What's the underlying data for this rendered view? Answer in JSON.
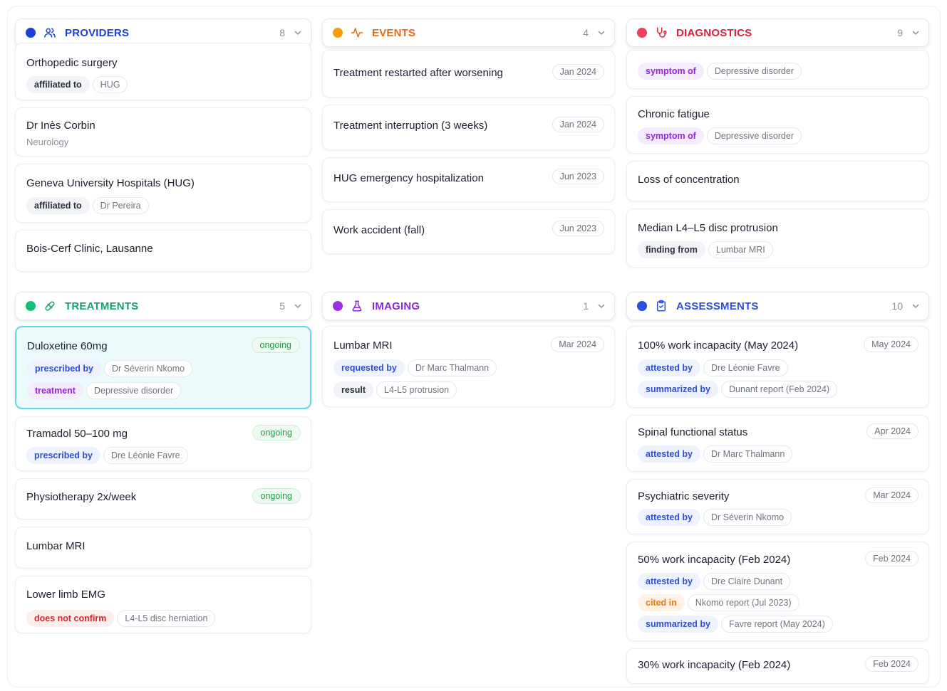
{
  "colors": {
    "providers": "#1e40d8",
    "events": "#f59e0b",
    "events_title": "#ea6a12",
    "diagnostics": "#f03e5f",
    "diagnostics_title": "#dc1f3c",
    "treatments": "#16c07a",
    "treatments_title": "#13a36a",
    "imaging": "#9b30e8",
    "imaging_title": "#8a28d6",
    "assessments": "#2d4fe0"
  },
  "providers": {
    "title": "PROVIDERS",
    "icon": "users-icon",
    "count": "8",
    "cards": [
      {
        "title": "Orthopedic surgery",
        "relation": "affiliated to",
        "target": "HUG"
      },
      {
        "title": "Dr Inès Corbin",
        "subtitle": "Neurology"
      },
      {
        "title": "Geneva University Hospitals (HUG)",
        "relation": "affiliated to",
        "target": "Dr Pereira"
      },
      {
        "title": "Bois-Cerf Clinic, Lausanne"
      }
    ]
  },
  "events": {
    "title": "EVENTS",
    "icon": "activity-icon",
    "count": "4",
    "cards": [
      {
        "title": "Treatment restarted after worsening",
        "date": "Jan 2024"
      },
      {
        "title": "Treatment interruption (3 weeks)",
        "date": "Jan 2024"
      },
      {
        "title": "HUG emergency hospitalization",
        "date": "Jun 2023"
      },
      {
        "title": "Work accident (fall)",
        "date": "Jun 2023"
      }
    ]
  },
  "diagnostics": {
    "title": "DIAGNOSTICS",
    "icon": "stethoscope-icon",
    "count": "9",
    "cards": [
      {
        "relation": "symptom of",
        "target": "Depressive disorder"
      },
      {
        "title": "Chronic fatigue",
        "relation": "symptom of",
        "target": "Depressive disorder"
      },
      {
        "title": "Loss of concentration"
      },
      {
        "title": "Median L4–L5 disc protrusion",
        "relation": "finding from",
        "target": "Lumbar MRI"
      }
    ]
  },
  "treatments": {
    "title": "TREATMENTS",
    "icon": "pill-icon",
    "count": "5",
    "cards": [
      {
        "title": "Duloxetine 60mg",
        "status": "ongoing",
        "relations": [
          {
            "relation": "prescribed by",
            "target": "Dr Séverin Nkomo"
          },
          {
            "relation": "treatment",
            "target": "Depressive disorder"
          }
        ]
      },
      {
        "title": "Tramadol 50–100 mg",
        "status": "ongoing",
        "relations": [
          {
            "relation": "prescribed by",
            "target": "Dre Léonie Favre"
          }
        ]
      },
      {
        "title": "Physiotherapy 2x/week",
        "status": "ongoing"
      },
      {
        "title": "Lumbar MRI"
      },
      {
        "title": "Lower limb EMG",
        "relations": [
          {
            "relation": "does not confirm",
            "target": "L4-L5 disc herniation"
          }
        ]
      }
    ]
  },
  "imaging": {
    "title": "IMAGING",
    "icon": "flask-icon",
    "count": "1",
    "cards": [
      {
        "title": "Lumbar MRI",
        "date": "Mar 2024",
        "relations": [
          {
            "relation": "requested by",
            "target": "Dr Marc Thalmann"
          },
          {
            "relation": "result",
            "target": "L4-L5 protrusion"
          }
        ]
      }
    ]
  },
  "assessments": {
    "title": "ASSESSMENTS",
    "icon": "clipboard-icon",
    "count": "10",
    "cards": [
      {
        "title": "100% work incapacity (May 2024)",
        "date": "May 2024",
        "relations": [
          {
            "relation": "attested by",
            "target": "Dre Léonie Favre"
          },
          {
            "relation": "summarized by",
            "target": "Dunant report (Feb 2024)"
          }
        ]
      },
      {
        "title": "Spinal functional status",
        "date": "Apr 2024",
        "relations": [
          {
            "relation": "attested by",
            "target": "Dr Marc Thalmann"
          }
        ]
      },
      {
        "title": "Psychiatric severity",
        "date": "Mar 2024",
        "relations": [
          {
            "relation": "attested by",
            "target": "Dr Séverin Nkomo"
          }
        ]
      },
      {
        "title": "50% work incapacity (Feb 2024)",
        "date": "Feb 2024",
        "relations": [
          {
            "relation": "attested by",
            "target": "Dre Claire Dunant"
          },
          {
            "relation": "cited in",
            "target": "Nkomo report (Jul 2023)"
          },
          {
            "relation": "summarized by",
            "target": "Favre report (May 2024)"
          }
        ]
      },
      {
        "title": "30% work incapacity (Feb 2024)",
        "date": "Feb 2024"
      }
    ]
  }
}
